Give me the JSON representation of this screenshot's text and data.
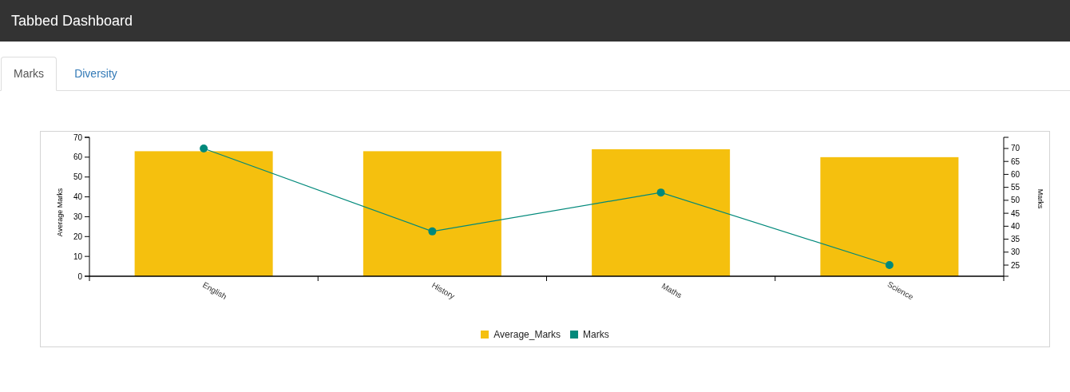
{
  "header": {
    "title": "Tabbed Dashboard"
  },
  "tabs": [
    {
      "label": "Marks",
      "selected": true
    },
    {
      "label": "Diversity",
      "selected": false
    }
  ],
  "bar_chart": {
    "chart_data": {
      "type": "bar",
      "categories": [
        "English",
        "History",
        "Maths",
        "Science"
      ],
      "ylabel": "Average Marks",
      "ylim": [
        0,
        70
      ],
      "yticks": [
        0,
        10,
        20,
        30,
        40,
        50,
        60,
        70
      ],
      "series": [
        {
          "name": "Average_Marks",
          "color": "#f5c00e",
          "values": [
            63,
            63,
            64,
            60
          ]
        }
      ]
    }
  },
  "line_chart": {
    "chart_data": {
      "type": "line",
      "categories": [
        null,
        null,
        null,
        null
      ],
      "ylabel": "Marks",
      "ylim": [
        20.7,
        74.3
      ],
      "yticks": [
        25,
        30,
        35,
        40,
        45,
        50,
        55,
        60,
        65,
        70
      ],
      "series": [
        {
          "name": "Marks",
          "color": "#00897b",
          "marker": "circle",
          "values": [
            70,
            38,
            53,
            25
          ]
        }
      ]
    }
  }
}
